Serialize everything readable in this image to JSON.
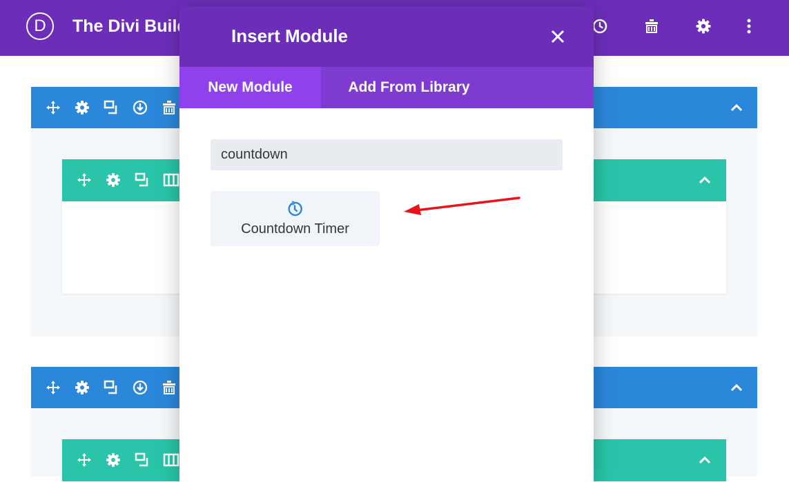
{
  "app": {
    "title": "The Divi Builder",
    "logo_letter": "D"
  },
  "modal": {
    "title": "Insert Module",
    "tabs": [
      {
        "label": "New Module",
        "active": true
      },
      {
        "label": "Add From Library",
        "active": false
      }
    ],
    "search_value": "countdown",
    "results": [
      {
        "label": "Countdown Timer",
        "icon": "clock-icon"
      }
    ]
  },
  "colors": {
    "topbar": "#6c2eb9",
    "section_header": "#2b87da",
    "row_header": "#29c4a9",
    "tab_active": "#8f42ec",
    "annotation_arrow": "#e8141b"
  },
  "section_tools": [
    "move-icon",
    "gear-icon",
    "duplicate-icon",
    "save-icon",
    "trash-icon"
  ],
  "row_tools": [
    "move-icon",
    "gear-icon",
    "duplicate-icon",
    "columns-icon"
  ]
}
